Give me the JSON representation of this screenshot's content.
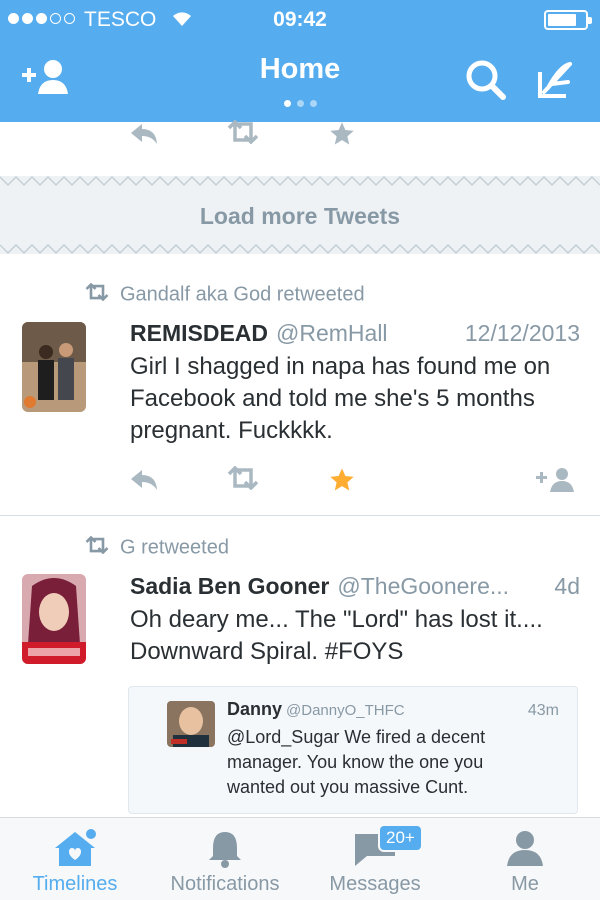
{
  "status_bar": {
    "carrier": "TESCO",
    "time": "09:42"
  },
  "header": {
    "title": "Home"
  },
  "load_more": {
    "label": "Load more Tweets"
  },
  "tweets": [
    {
      "retweeted_by": "Gandalf aka God retweeted",
      "name": "REMISDEAD",
      "handle": "@RemHall",
      "timestamp": "12/12/2013",
      "text": "Girl I shagged in napa has found me on Facebook and told me she's 5 months pregnant. Fuckkkk.",
      "favorited": true
    },
    {
      "retweeted_by": "G retweeted",
      "name": "Sadia Ben Gooner",
      "handle": "@TheGoonere...",
      "timestamp": "4d",
      "text": "Oh deary me... The \"Lord\" has lost it.... Downward Spiral. #FOYS",
      "quote": {
        "name": "Danny",
        "handle": "@DannyO_THFC",
        "timestamp": "43m",
        "text": "@Lord_Sugar We fired a decent manager. You know the one you wanted out you massive Cunt."
      }
    }
  ],
  "tabs": [
    {
      "label": "Timelines",
      "icon": "home-icon",
      "active": true
    },
    {
      "label": "Notifications",
      "icon": "bell-icon"
    },
    {
      "label": "Messages",
      "icon": "messages-icon",
      "badge": "20+"
    },
    {
      "label": "Me",
      "icon": "profile-icon"
    }
  ],
  "colors": {
    "brand": "#55acee",
    "favorite": "#ffac33",
    "muted": "#8899a6",
    "text": "#292f33"
  }
}
